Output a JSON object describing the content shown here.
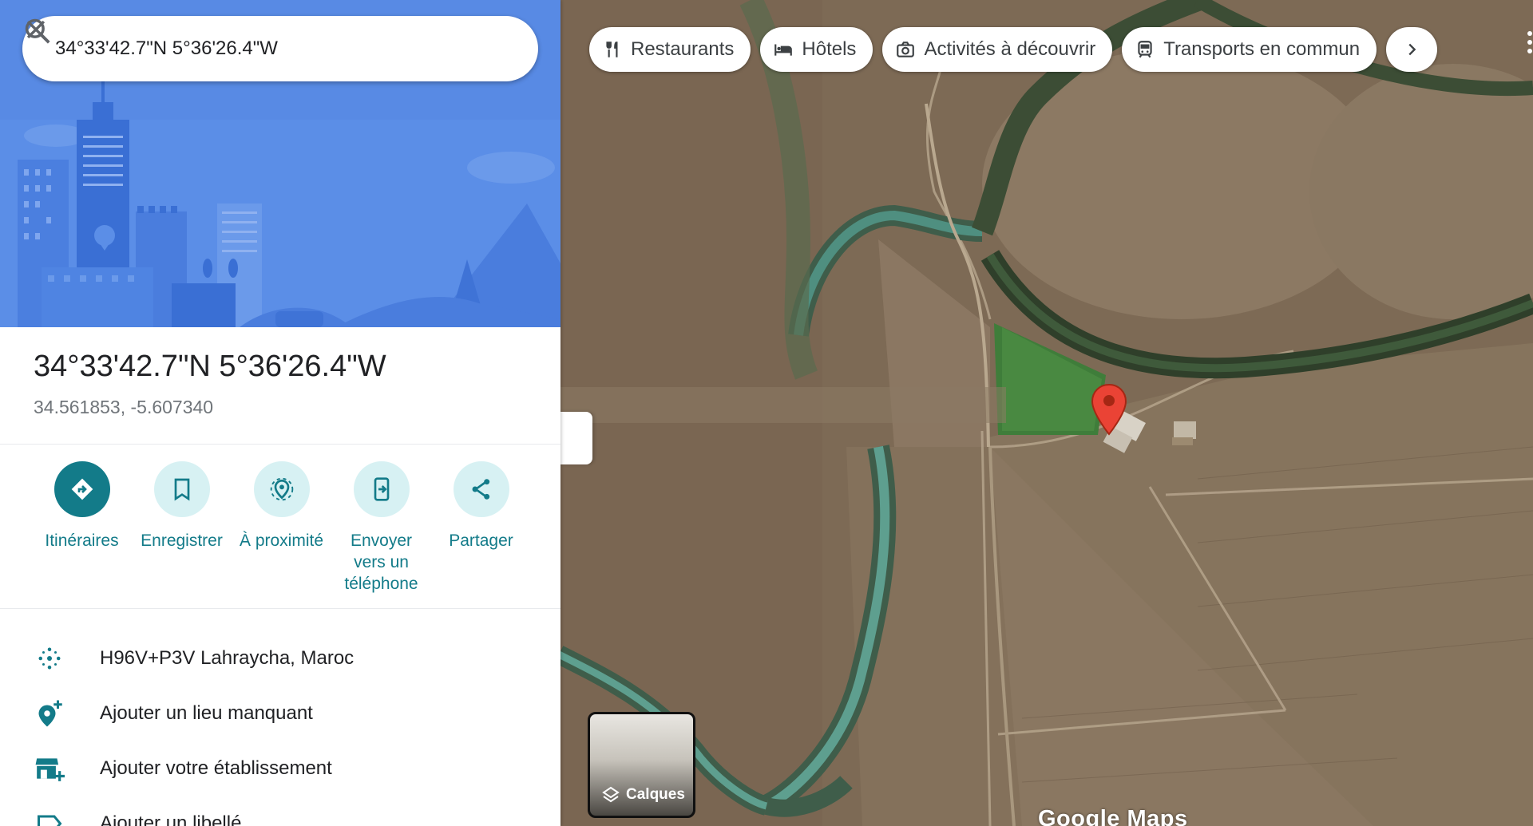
{
  "search": {
    "value": "34°33'42.7\"N 5°36'26.4\"W"
  },
  "place": {
    "title": "34°33'42.7\"N 5°36'26.4\"W",
    "decimal_coordinates": "34.561853, -5.607340"
  },
  "actions": [
    {
      "label": "Itinéraires",
      "icon": "directions-icon"
    },
    {
      "label": "Enregistrer",
      "icon": "bookmark-icon"
    },
    {
      "label": "À proximité",
      "icon": "nearby-icon"
    },
    {
      "label": "Envoyer\nvers un\ntéléphone",
      "icon": "send-to-phone-icon"
    },
    {
      "label": "Partager",
      "icon": "share-icon"
    }
  ],
  "info_rows": [
    {
      "text": "H96V+P3V Lahraycha, Maroc",
      "icon": "plus-code-icon"
    },
    {
      "text": "Ajouter un lieu manquant",
      "icon": "add-place-icon"
    },
    {
      "text": "Ajouter votre établissement",
      "icon": "add-business-icon"
    },
    {
      "text": "Ajouter un libellé",
      "icon": "label-icon"
    }
  ],
  "map": {
    "chips": [
      {
        "label": "Restaurants",
        "icon": "fork-knife-icon"
      },
      {
        "label": "Hôtels",
        "icon": "bed-icon"
      },
      {
        "label": "Activités à découvrir",
        "icon": "camera-icon"
      },
      {
        "label": "Transports en commun",
        "icon": "train-icon"
      }
    ],
    "layers_label": "Calques",
    "logo": "Google Maps"
  },
  "colors": {
    "accent": "#137b89",
    "accent_light": "#d7f1f3",
    "hero_blue": "#5b8ee7",
    "pin_red": "#ea4335"
  }
}
